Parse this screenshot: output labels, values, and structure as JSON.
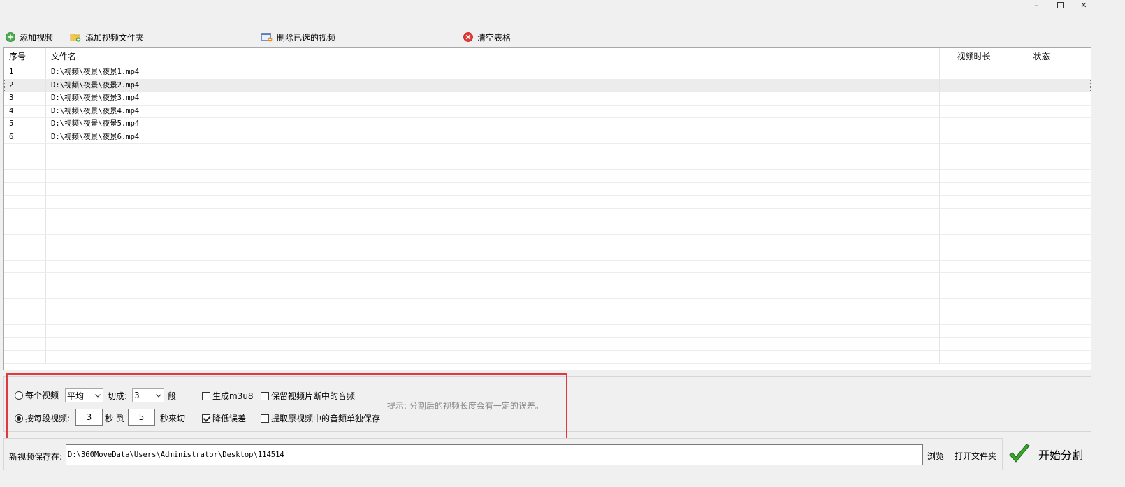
{
  "window": {
    "minimize_glyph": "–",
    "maximize_icon": "maximize-icon",
    "close_glyph": "✕"
  },
  "toolbar": {
    "add_video": "添加视频",
    "add_folder": "添加视频文件夹",
    "delete_selected": "删除已选的视频",
    "clear_table": "清空表格"
  },
  "table": {
    "headers": {
      "seq": "序号",
      "filename": "文件名",
      "duration": "视频时长",
      "status": "状态"
    },
    "rows": [
      {
        "seq": "1",
        "filename": "D:\\视频\\夜景\\夜景1.mp4",
        "duration": "",
        "status": ""
      },
      {
        "seq": "2",
        "filename": "D:\\视频\\夜景\\夜景2.mp4",
        "duration": "",
        "status": ""
      },
      {
        "seq": "3",
        "filename": "D:\\视频\\夜景\\夜景3.mp4",
        "duration": "",
        "status": ""
      },
      {
        "seq": "4",
        "filename": "D:\\视频\\夜景\\夜景4.mp4",
        "duration": "",
        "status": ""
      },
      {
        "seq": "5",
        "filename": "D:\\视频\\夜景\\夜景5.mp4",
        "duration": "",
        "status": ""
      },
      {
        "seq": "6",
        "filename": "D:\\视频\\夜景\\夜景6.mp4",
        "duration": "",
        "status": ""
      }
    ],
    "selected_row": 2
  },
  "options": {
    "mode_each_label": "每个视频",
    "mode_each_selected": false,
    "split_method": "平均",
    "cut_into_label": "切成:",
    "segments_value": "3",
    "segments_unit": "段",
    "mode_per_segment_label": "按每段视频:",
    "mode_per_segment_selected": true,
    "min_seconds": "3",
    "seconds_unit": "秒",
    "to_label": "到",
    "max_seconds": "5",
    "seconds_cut_label": "秒来切",
    "gen_m3u8_label": "生成m3u8",
    "gen_m3u8_checked": false,
    "reduce_error_label": "降低误差",
    "reduce_error_checked": true,
    "keep_audio_label": "保留视频片断中的音频",
    "keep_audio_checked": false,
    "extract_audio_label": "提取原视频中的音频单独保存",
    "extract_audio_checked": false,
    "hint": "提示: 分割后的视频长度会有一定的误差。"
  },
  "output": {
    "save_label": "新视频保存在:",
    "save_path": "D:\\360MoveData\\Users\\Administrator\\Desktop\\114514",
    "browse": "浏览",
    "open_folder": "打开文件夹",
    "start": "开始分割"
  },
  "colors": {
    "highlight_box": "#e0393e",
    "add_icon": "#4caf50",
    "clear_icon": "#e53935",
    "start_check": "#3aa52f"
  }
}
